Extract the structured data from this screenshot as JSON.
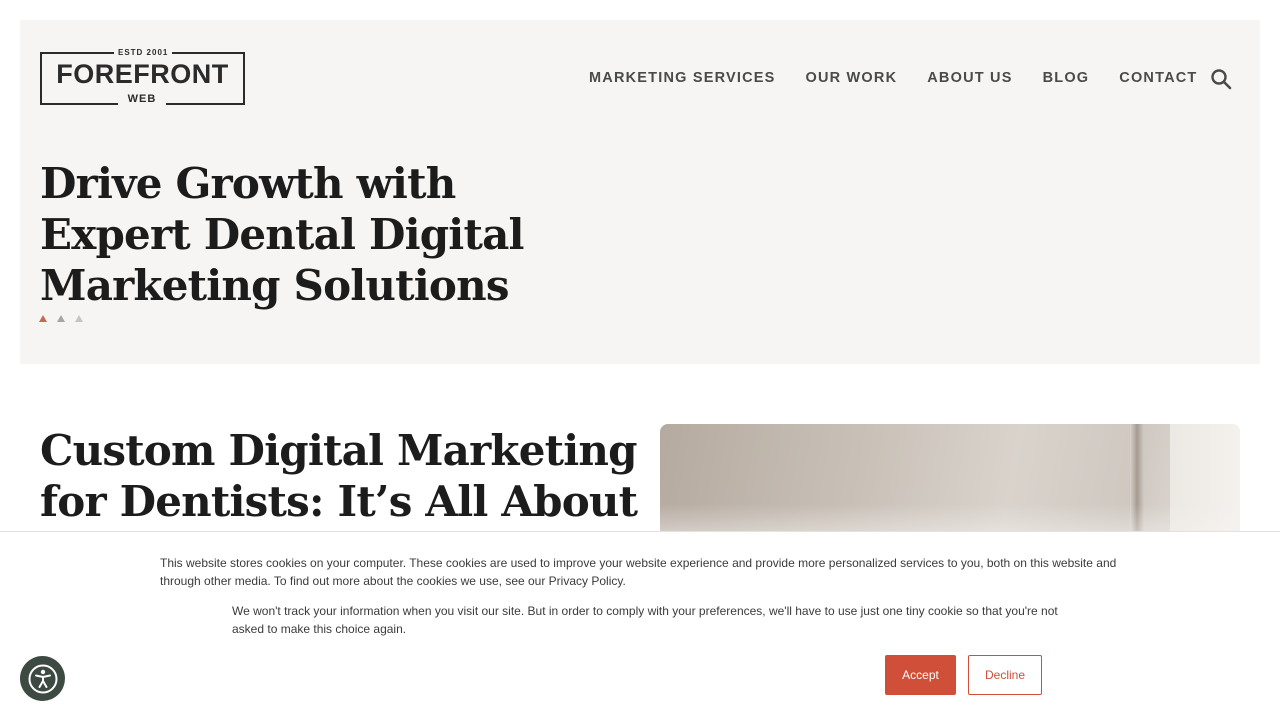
{
  "logo": {
    "est": "ESTD 2001",
    "main": "FOREFRONT",
    "sub": "WEB"
  },
  "nav": {
    "items": [
      "MARKETING SERVICES",
      "OUR WORK",
      "ABOUT US",
      "BLOG",
      "CONTACT"
    ],
    "search_icon": "search-icon"
  },
  "hero": {
    "title_lines": [
      "Drive Growth with",
      "Expert Dental Digital",
      "Marketing Solutions"
    ],
    "slider_dots": {
      "count": 3,
      "active": 1
    }
  },
  "section": {
    "title_lines": [
      "Custom Digital Marketing",
      "for Dentists: It’s All About"
    ]
  },
  "cookie_banner": {
    "text1": "This website stores cookies on your computer. These cookies are used to improve your website experience and provide more personalized services to you, both on this website and through other media. To find out more about the cookies we use, see our Privacy Policy.",
    "text2": "We won't track your information when you visit our site. But in order to comply with your preferences, we'll have to use just one tiny cookie so that you're not asked to make this choice again.",
    "accept_label": "Accept",
    "decline_label": "Decline",
    "accent_color": "#cf4f38"
  },
  "accessibility_icon": "accessibility-icon"
}
